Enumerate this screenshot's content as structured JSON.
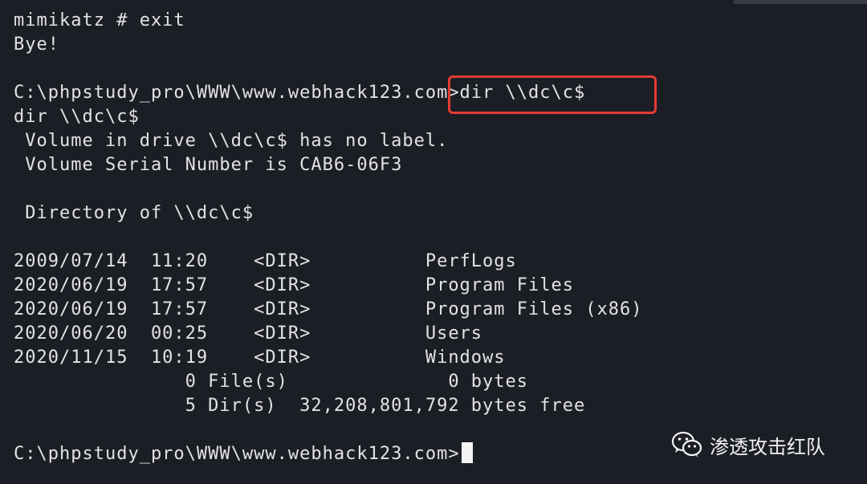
{
  "terminal": {
    "lines": [
      "mimikatz # exit",
      "Bye!",
      "",
      "C:\\phpstudy_pro\\WWW\\www.webhack123.com>dir \\\\dc\\c$",
      "dir \\\\dc\\c$",
      " Volume in drive \\\\dc\\c$ has no label.",
      " Volume Serial Number is CAB6-06F3",
      "",
      " Directory of \\\\dc\\c$",
      "",
      "2009/07/14  11:20    <DIR>          PerfLogs",
      "2020/06/19  17:57    <DIR>          Program Files",
      "2020/06/19  17:57    <DIR>          Program Files (x86)",
      "2020/06/20  00:25    <DIR>          Users",
      "2020/11/15  10:19    <DIR>          Windows",
      "               0 File(s)              0 bytes",
      "               5 Dir(s)  32,208,801,792 bytes free",
      "",
      "C:\\phpstudy_pro\\WWW\\www.webhack123.com>"
    ]
  },
  "watermark": {
    "text": "渗透攻击红队",
    "icon": "wechat-icon"
  },
  "colors": {
    "background": "#1c1e26",
    "text": "#e3e3e3",
    "highlight": "#e53b33"
  }
}
